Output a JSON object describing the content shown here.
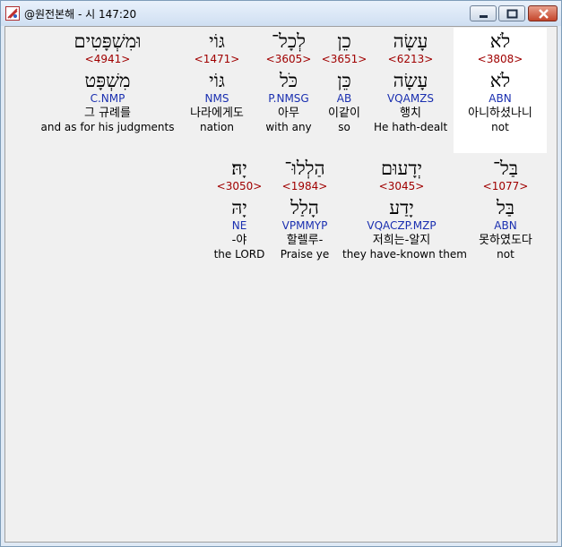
{
  "window": {
    "title": "@원전본해 - 시 147:20",
    "colors": {
      "strong": "#a00000",
      "morph": "#1a2fb0",
      "selected_bg": "#ffffff",
      "client_bg": "#f0f0f0"
    }
  },
  "rows": [
    {
      "words": [
        {
          "hebrew": "לֹא",
          "strong": "<3808>",
          "lemma": "לֹא",
          "morph": "ABN",
          "korean": "아니하셨나니",
          "english": "not",
          "selected": true
        },
        {
          "hebrew": "עָשָׂה",
          "strong": "<6213>",
          "lemma": "עָשָׂה",
          "morph": "VQAMZS",
          "korean": "행치",
          "english": "He hath-dealt"
        },
        {
          "hebrew": "כֵן",
          "strong": "<3651>",
          "lemma": "כֵּן",
          "morph": "AB",
          "korean": "이같이",
          "english": "so"
        },
        {
          "hebrew": "לְכָל־",
          "strong": "<3605>",
          "lemma": "כֹּל",
          "morph": "P.NMSG",
          "korean": "아무",
          "english": "with any"
        },
        {
          "hebrew": "גּוֹי",
          "strong": "<1471>",
          "lemma": "גּוֹי",
          "morph": "NMS",
          "korean": "나라에게도",
          "english": "nation"
        },
        {
          "hebrew": "וּמִשְׁפָּטִים",
          "strong": "<4941>",
          "lemma": "מִשְׁפָּט",
          "morph": "C.NMP",
          "korean": "그 규례를",
          "english": "and as for his judgments"
        }
      ]
    },
    {
      "words": [
        {
          "hebrew": "בַּל־",
          "strong": "<1077>",
          "lemma": "בַּל",
          "morph": "ABN",
          "korean": "못하였도다",
          "english": "not"
        },
        {
          "hebrew": "יְדָעוּם",
          "strong": "<3045>",
          "lemma": "יָדַע",
          "morph": "VQACZP.MZP",
          "korean": "저희는-알지",
          "english": "they have-known them"
        },
        {
          "hebrew": "הַלְלוּ־",
          "strong": "<1984>",
          "lemma": "הָלַל",
          "morph": "VPMMYP",
          "korean": "할렐루-",
          "english": "Praise ye"
        },
        {
          "hebrew": "יָהּ׃",
          "strong": "<3050>",
          "lemma": "יָהּ",
          "morph": "NE",
          "korean": "-야",
          "english": "the LORD"
        }
      ]
    }
  ]
}
